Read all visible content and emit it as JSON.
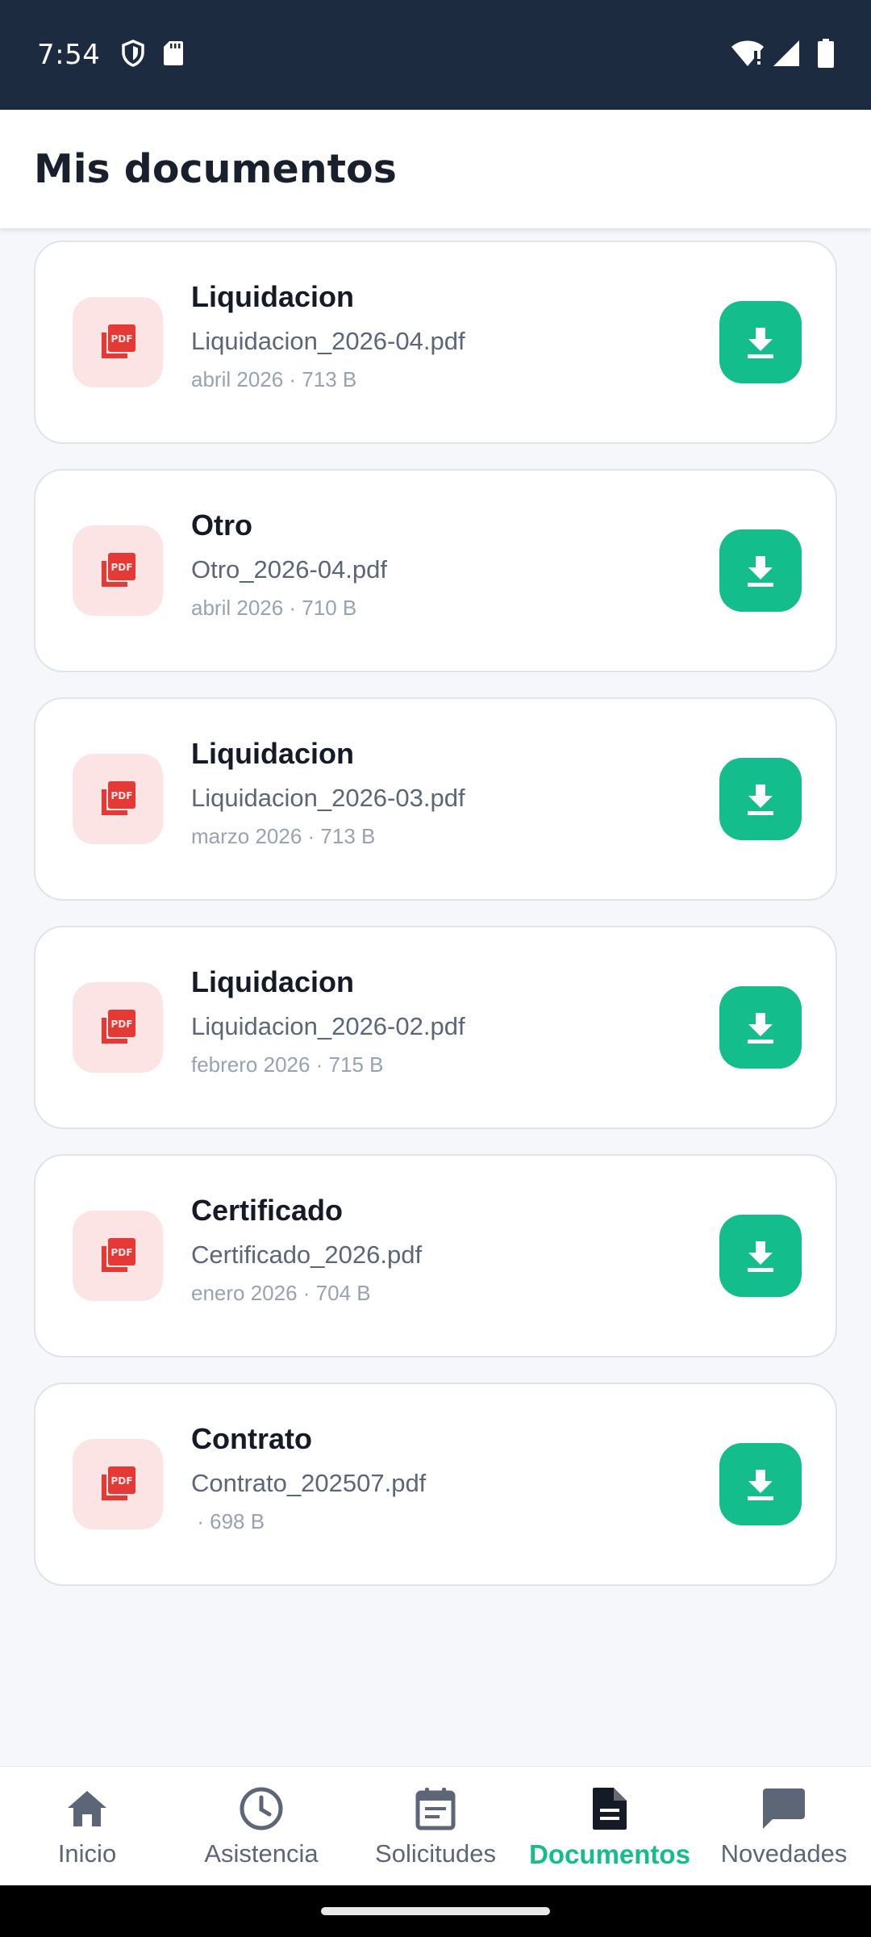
{
  "status_bar": {
    "time": "7:54",
    "icons_left": [
      "shield-icon",
      "sd-card-icon"
    ],
    "icons_right": [
      "wifi-alert-icon",
      "signal-icon",
      "battery-icon"
    ]
  },
  "header": {
    "title": "Mis documentos"
  },
  "colors": {
    "accent": "#13bd8c",
    "status_bar": "#1c2b40",
    "pdf_badge_bg": "#fde4e4",
    "pdf_icon": "#e53935",
    "background": "#f5f7fa"
  },
  "documents": [
    {
      "title": "Liquidacion",
      "file": "Liquidacion_2026-04.pdf",
      "meta": "abril 2026 · 713 B",
      "icon": "pdf-icon",
      "action_icon": "download-icon"
    },
    {
      "title": "Otro",
      "file": "Otro_2026-04.pdf",
      "meta": "abril 2026 · 710 B",
      "icon": "pdf-icon",
      "action_icon": "download-icon"
    },
    {
      "title": "Liquidacion",
      "file": "Liquidacion_2026-03.pdf",
      "meta": "marzo 2026 · 713 B",
      "icon": "pdf-icon",
      "action_icon": "download-icon"
    },
    {
      "title": "Liquidacion",
      "file": "Liquidacion_2026-02.pdf",
      "meta": "febrero 2026 · 715 B",
      "icon": "pdf-icon",
      "action_icon": "download-icon"
    },
    {
      "title": "Certificado",
      "file": "Certificado_2026.pdf",
      "meta": "enero 2026 · 704 B",
      "icon": "pdf-icon",
      "action_icon": "download-icon"
    },
    {
      "title": "Contrato",
      "file": "Contrato_202507.pdf",
      "meta": " · 698 B",
      "icon": "pdf-icon",
      "action_icon": "download-icon"
    }
  ],
  "bottom_nav": {
    "items": [
      {
        "label": "Inicio",
        "icon": "home-icon",
        "active": false
      },
      {
        "label": "Asistencia",
        "icon": "clock-icon",
        "active": false
      },
      {
        "label": "Solicitudes",
        "icon": "calendar-icon",
        "active": false
      },
      {
        "label": "Documentos",
        "icon": "document-icon",
        "active": true
      },
      {
        "label": "Novedades",
        "icon": "chat-icon",
        "active": false
      }
    ]
  }
}
